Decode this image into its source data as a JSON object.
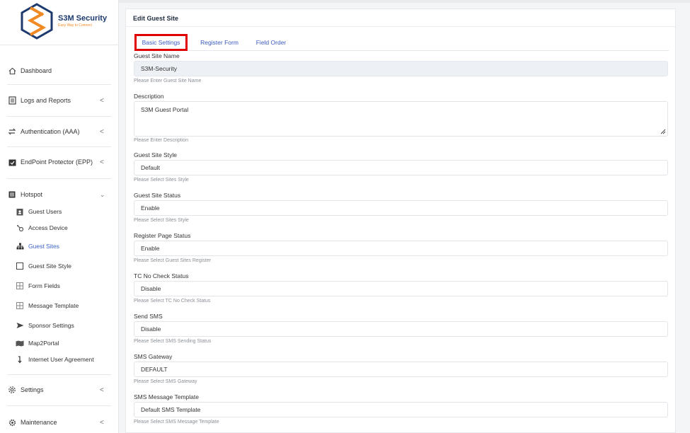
{
  "brand": {
    "name": "S3M Security",
    "tagline": "Easy Way to Connect"
  },
  "sidebar": {
    "items": [
      {
        "label": "Dashboard",
        "icon": "home-icon"
      },
      {
        "label": "Logs and Reports",
        "icon": "document-icon",
        "chevron": "<"
      },
      {
        "label": "Authentication (AAA)",
        "icon": "sync-icon",
        "chevron": "<"
      },
      {
        "label": "EndPoint Protector (EPP)",
        "icon": "calendar-check-icon",
        "chevron": "<"
      },
      {
        "label": "Hotspot",
        "icon": "list-icon",
        "chevron": "v"
      },
      {
        "label": "Settings",
        "icon": "gear-icon",
        "chevron": "<"
      },
      {
        "label": "Maintenance",
        "icon": "cog-icon",
        "chevron": "<"
      }
    ],
    "hotspot_sub": [
      {
        "label": "Guest Users",
        "icon": "id-badge-icon"
      },
      {
        "label": "Access Device",
        "icon": "hubspot-icon"
      },
      {
        "label": "Guest Sites",
        "icon": "sitemap-icon",
        "active": true
      },
      {
        "label": "Guest Site Style",
        "icon": "square-icon"
      },
      {
        "label": "Form Fields",
        "icon": "grid-icon"
      },
      {
        "label": "Message Template",
        "icon": "grid-icon"
      },
      {
        "label": "Sponsor Settings",
        "icon": "send-icon"
      },
      {
        "label": "Map2Portal",
        "icon": "map-icon"
      },
      {
        "label": "Internet User Agreement",
        "icon": "arrow-down-icon"
      }
    ]
  },
  "main": {
    "title": "Edit Guest Site",
    "tabs": [
      "Basic Settings",
      "Register Form",
      "Field Order"
    ],
    "fields": {
      "site_name": {
        "label": "Guest Site Name",
        "value": "S3M-Security",
        "help": "Please Enter Guest Site Name"
      },
      "description": {
        "label": "Description",
        "value": "S3M Guest Portal",
        "help": "Please Enter Description"
      },
      "site_style": {
        "label": "Guest Site Style",
        "value": "Default",
        "help": "Please Select Sites Style"
      },
      "site_status": {
        "label": "Guest Site Status",
        "value": "Enable",
        "help": "Please Select Sites Style"
      },
      "register_status": {
        "label": "Register Page Status",
        "value": "Enable",
        "help": "Please Select Guest Sites Register"
      },
      "tc_status": {
        "label": "TC No Check Status",
        "value": "Disable",
        "help": "Please Select TC No Check Status"
      },
      "send_sms": {
        "label": "Send SMS",
        "value": "Disable",
        "help": "Please Select SMS Sending Status"
      },
      "sms_gateway": {
        "label": "SMS Gateway",
        "value": "DEFAULT",
        "help": "Please Select SMS Gateway"
      },
      "sms_template": {
        "label": "SMS Message Template",
        "value": "Default SMS Template",
        "help": "Please Select SMS Message Template"
      }
    }
  },
  "colors": {
    "accent": "#3a5bbf",
    "highlight": "#e00000",
    "brand_navy": "#1c3a6e",
    "brand_orange": "#f08a24"
  }
}
